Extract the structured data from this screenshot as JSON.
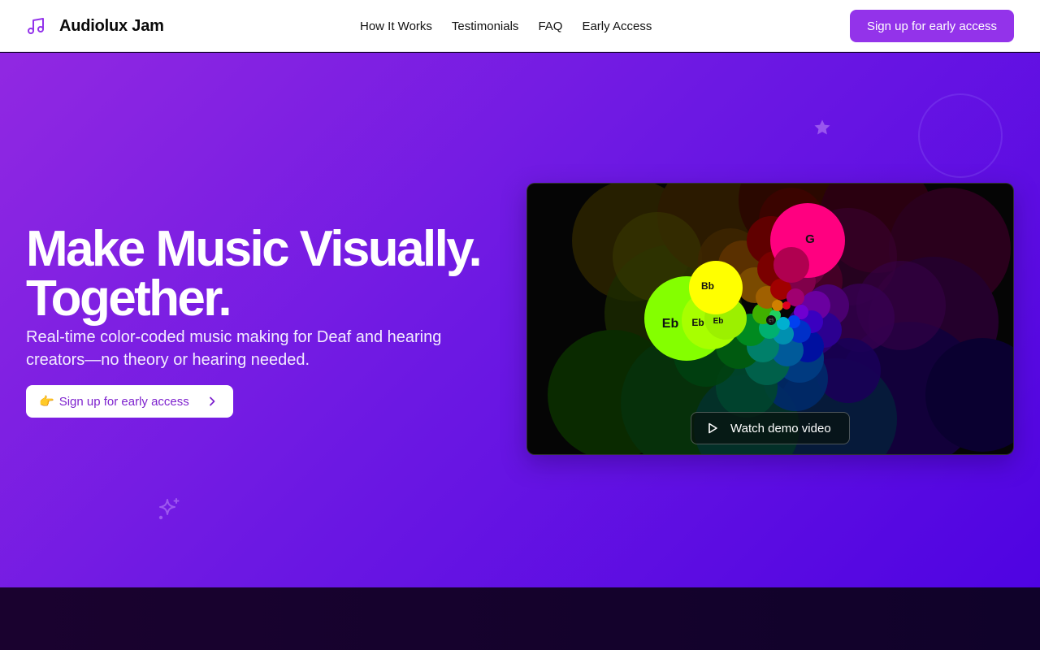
{
  "header": {
    "brand_name": "Audiolux Jam",
    "brand_icon": "music-note-icon",
    "nav": [
      "How It Works",
      "Testimonials",
      "FAQ",
      "Early Access"
    ],
    "cta_label": "Sign up for early access"
  },
  "hero": {
    "headline_line1": "Make Music Visually.",
    "headline_line2": "Together.",
    "subhead": "Real-time color-coded music making for Deaf and hearing creators—no theory or hearing needed.",
    "cta_emoji": "👉",
    "cta_label": "Sign up for early access",
    "video": {
      "button_label": "Watch demo video",
      "notes": [
        "G",
        "Bb",
        "Eb",
        "Eb",
        "Eb",
        "G"
      ]
    }
  },
  "colors": {
    "accent": "#9333ea",
    "hero_gradient_start": "#9128e2",
    "hero_gradient_end": "#4f03e2",
    "cta_text": "#7e22ce"
  }
}
